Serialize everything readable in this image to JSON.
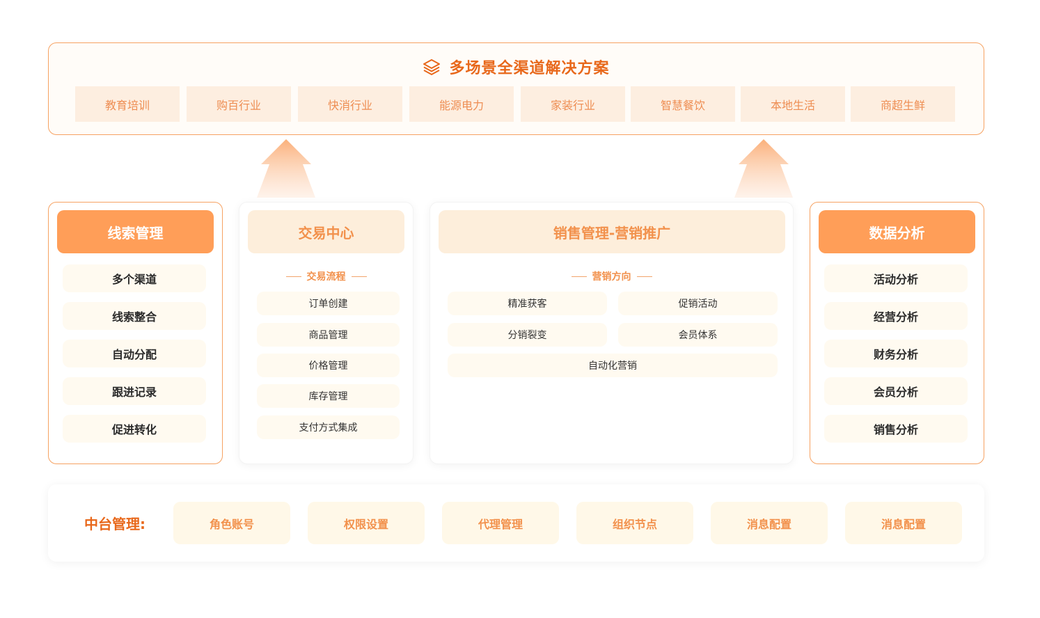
{
  "header": {
    "title": "多场景全渠道解决方案",
    "icon": "layers-icon",
    "scenarios": [
      "教育培训",
      "购百行业",
      "快消行业",
      "能源电力",
      "家装行业",
      "智慧餐饮",
      "本地生活",
      "商超生鲜"
    ]
  },
  "leads": {
    "title": "线索管理",
    "items": [
      "多个渠道",
      "线索整合",
      "自动分配",
      "跟进记录",
      "促进转化"
    ]
  },
  "trade": {
    "title": "交易中心",
    "subtitle": "交易流程",
    "items": [
      "订单创建",
      "商品管理",
      "价格管理",
      "库存管理",
      "支付方式集成"
    ]
  },
  "marketing": {
    "title": "销售管理-营销推广",
    "subtitle": "营销方向",
    "items": [
      "精准获客",
      "促销活动",
      "分销裂变",
      "会员体系",
      "自动化营销"
    ]
  },
  "analytics": {
    "title": "数据分析",
    "items": [
      "活动分析",
      "经营分析",
      "财务分析",
      "会员分析",
      "销售分析"
    ]
  },
  "middle": {
    "label": "中台管理:",
    "items": [
      "角色账号",
      "权限设置",
      "代理管理",
      "组织节点",
      "消息配置",
      "消息配置"
    ]
  },
  "colors": {
    "accent": "#e8681b",
    "light_orange": "#ff9e58",
    "soft_fill": "#fdeedb",
    "item_fill": "#fffaf0"
  }
}
